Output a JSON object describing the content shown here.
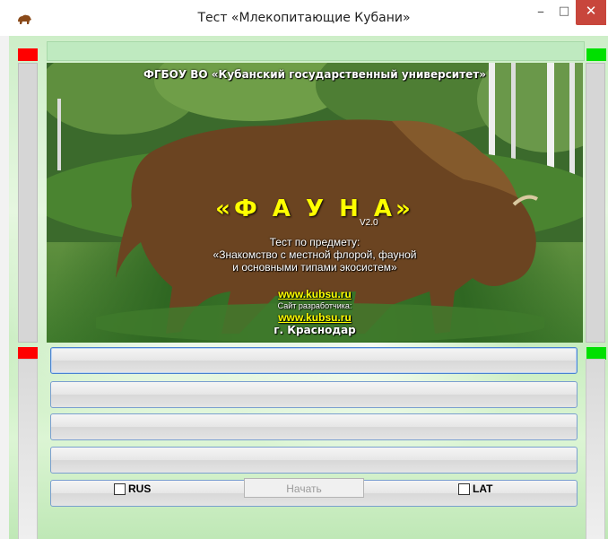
{
  "window": {
    "title": "Тест «Млекопитающие Кубани»",
    "minimize_glyph": "–",
    "maximize_glyph": "□",
    "close_glyph": "✕",
    "app_icon": "bison-icon"
  },
  "colors": {
    "indicator_red": "#ff0000",
    "indicator_green": "#00e000",
    "accent_yellow": "#ffff00",
    "close_button": "#c8463c"
  },
  "splash": {
    "university": "ФГБОУ ВО «Кубанский государственный университет»",
    "product": "«Ф А У Н А»",
    "version": "V2.0",
    "subject_line1": "Тест по предмету:",
    "subject_line2": "«Знакомство с местной флорой, фауной",
    "subject_line3": "и основными типами экосистем»",
    "site_link": "www.kubsu.ru",
    "developer_label": "Сайт разработчика:",
    "developer_link": "www.kubsu.ru",
    "city": "г. Краснодар"
  },
  "answers": [
    {
      "label": ""
    },
    {
      "label": ""
    },
    {
      "label": ""
    },
    {
      "label": ""
    },
    {
      "label": ""
    }
  ],
  "controls": {
    "rus_label": "RUS",
    "lat_label": "LAT",
    "start_label": "Начать",
    "rus_checked": false,
    "lat_checked": false
  }
}
